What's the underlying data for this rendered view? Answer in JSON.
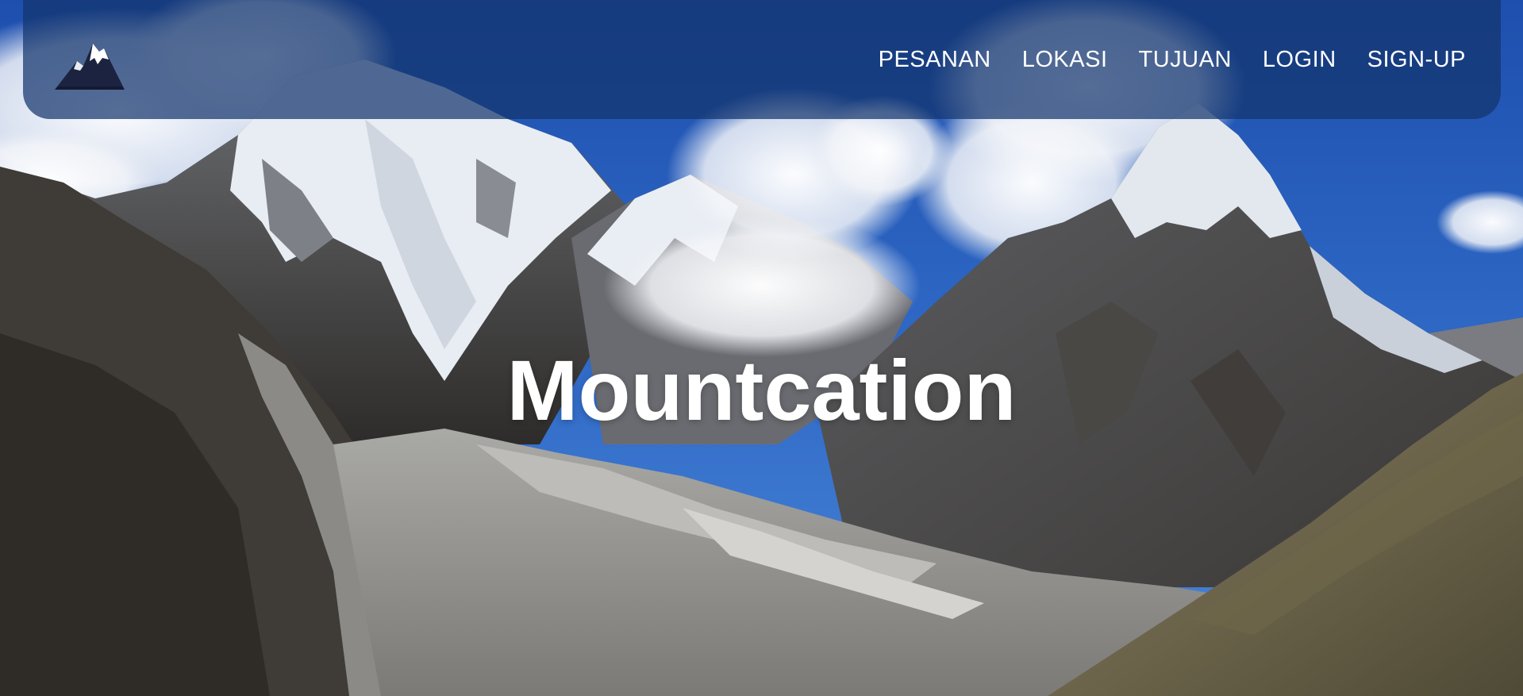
{
  "site": {
    "logo_icon": "mountain-logo-icon",
    "hero_title": "Mountcation"
  },
  "nav": {
    "items": [
      {
        "label": "PESANAN"
      },
      {
        "label": "LOKASI"
      },
      {
        "label": "TUJUAN"
      },
      {
        "label": "LOGIN"
      },
      {
        "label": "SIGN-UP"
      }
    ]
  },
  "colors": {
    "navbar_bg": "#14346e",
    "nav_text": "#ffffff",
    "title_text": "#ffffff",
    "sky": "#2a60b8"
  }
}
